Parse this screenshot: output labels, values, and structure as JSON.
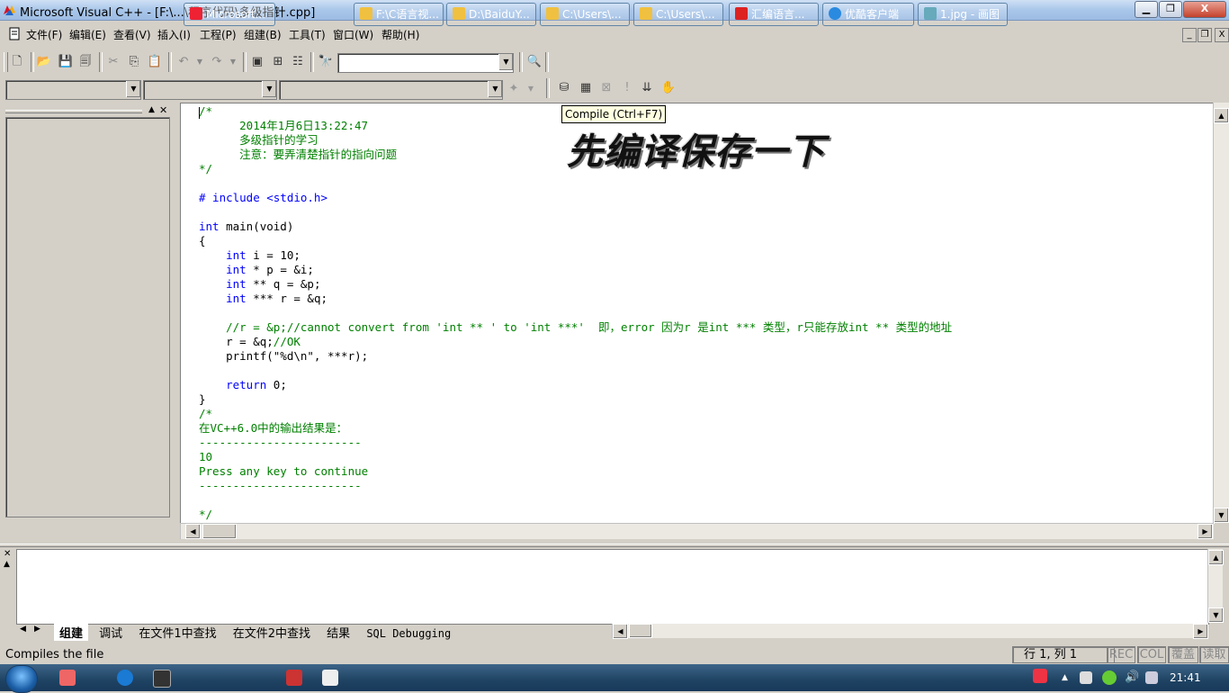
{
  "window": {
    "title": "Microsoft Visual C++ - [F:\\...\\程序代码\\多级指针.cpp]",
    "min_label": "▁",
    "max_label": "❐",
    "close_label": "X"
  },
  "menu": [
    "文件(F)",
    "编辑(E)",
    "查看(V)",
    "插入(I)",
    "工程(P)",
    "组建(B)",
    "工具(T)",
    "窗口(W)",
    "帮助(H)"
  ],
  "tooltip": "Compile (Ctrl+F7)",
  "overlay_text": "先编译保存一下",
  "code_lines": [
    {
      "cls": "cm",
      "text": "/*"
    },
    {
      "cls": "cm",
      "text": "      2014年1月6日13:22:47"
    },
    {
      "cls": "cm",
      "text": "      多级指针的学习"
    },
    {
      "cls": "cm",
      "text": "      注意：要弄清楚指针的指向问题"
    },
    {
      "cls": "cm",
      "text": "*/"
    },
    {
      "cls": "",
      "text": ""
    },
    {
      "cls": "kw",
      "text": "# include <stdio.h>"
    },
    {
      "cls": "",
      "text": ""
    },
    {
      "cls": "mix",
      "kw": "int",
      "text": " main(void)"
    },
    {
      "cls": "",
      "text": "{"
    },
    {
      "cls": "mix",
      "indent": "    ",
      "kw": "int",
      "text": " i = 10;"
    },
    {
      "cls": "mix",
      "indent": "    ",
      "kw": "int",
      "text": " * p = &i;"
    },
    {
      "cls": "mix",
      "indent": "    ",
      "kw": "int",
      "text": " ** q = &p;"
    },
    {
      "cls": "mix",
      "indent": "    ",
      "kw": "int",
      "text": " *** r = &q;"
    },
    {
      "cls": "",
      "text": ""
    },
    {
      "cls": "cm",
      "text": "    //r = &p;//cannot convert from 'int ** ' to 'int ***'  即，error 因为r 是int *** 类型，r只能存放int ** 类型的地址"
    },
    {
      "cls": "mixc",
      "text": "    r = &q;",
      "comment": "//OK"
    },
    {
      "cls": "",
      "text": "    printf(\"%d\\n\", ***r);"
    },
    {
      "cls": "",
      "text": ""
    },
    {
      "cls": "mix",
      "indent": "    ",
      "kw": "return",
      "text": " 0;"
    },
    {
      "cls": "",
      "text": "}"
    },
    {
      "cls": "cm",
      "text": "/*"
    },
    {
      "cls": "cm",
      "text": "在VC++6.0中的输出结果是："
    },
    {
      "cls": "cm",
      "text": "------------------------"
    },
    {
      "cls": "cm",
      "text": "10"
    },
    {
      "cls": "cm",
      "text": "Press any key to continue"
    },
    {
      "cls": "cm",
      "text": "------------------------"
    },
    {
      "cls": "",
      "text": ""
    },
    {
      "cls": "cm",
      "text": "*/"
    }
  ],
  "output_tabs": [
    "组建",
    "调试",
    "在文件1中查找",
    "在文件2中查找",
    "结果",
    "SQL Debugging"
  ],
  "status": {
    "message": "Compiles the file",
    "position": "行 1, 列 1",
    "rec": "REC",
    "col": "COL",
    "ovr": "覆盖",
    "read": "读取"
  },
  "taskbar": {
    "buttons": [
      "Microsoft...",
      "F:\\C语言视...",
      "D:\\BaiduY...",
      "C:\\Users\\...",
      "C:\\Users\\...",
      "汇编语言...",
      "优酷客户端",
      "1.jpg - 画图"
    ],
    "clock": "21:41"
  },
  "colors": {
    "keyword": "#0000ff",
    "comment": "#008000",
    "accent": "#1f4363"
  }
}
